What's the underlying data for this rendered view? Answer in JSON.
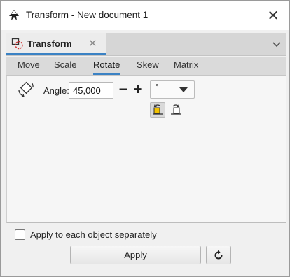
{
  "window": {
    "title": "Transform - New document 1",
    "app_icon": "inkscape-logo-icon",
    "close_glyph": "✕"
  },
  "notebook": {
    "tab_label": "Transform",
    "tab_icon": "transform-dialog-icon",
    "tab_close_glyph": "✕",
    "menu_icon": "chevron-down-icon"
  },
  "subtabs": [
    {
      "label": "Move",
      "active": false
    },
    {
      "label": "Scale",
      "active": false
    },
    {
      "label": "Rotate",
      "active": true
    },
    {
      "label": "Skew",
      "active": false
    },
    {
      "label": "Matrix",
      "active": false
    }
  ],
  "rotate": {
    "icon": "rotate-object-icon",
    "angle_label": "Angle:",
    "angle_value": "45,000",
    "minus_glyph": "−",
    "plus_glyph": "+",
    "unit_value": "°",
    "unit_icon": "dropdown-arrow-icon",
    "direction_ccw_icon": "rotate-counterclockwise-icon",
    "direction_cw_icon": "rotate-clockwise-icon",
    "direction_selected": "counterclockwise"
  },
  "options": {
    "apply_separately_label": "Apply to each object separately",
    "apply_separately_checked": false
  },
  "actions": {
    "apply_label": "Apply",
    "reset_icon": "reset-refresh-icon"
  },
  "colors": {
    "accent": "#3b82c4",
    "window_bg": "#f0f0f0",
    "header_bg": "#d6d6d6"
  }
}
